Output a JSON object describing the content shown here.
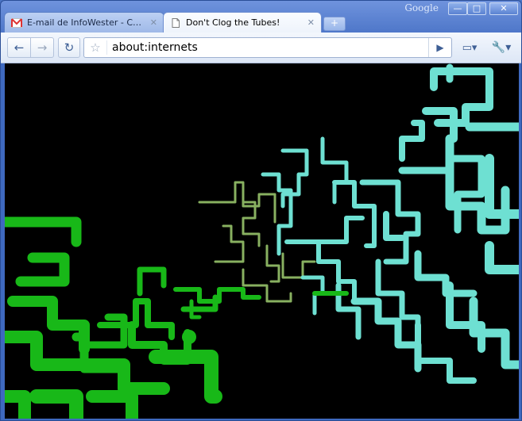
{
  "titlebar": {
    "brand": "Google",
    "minimize_glyph": "—",
    "maximize_glyph": "□",
    "close_glyph": "✕"
  },
  "tabs": [
    {
      "title": "E-mail de InfoWester - Cai...",
      "icon": "gmail-icon",
      "active": false
    },
    {
      "title": "Don't Clog the Tubes!",
      "icon": "page-icon",
      "active": true
    }
  ],
  "tab_close_glyph": "✕",
  "new_tab_glyph": "+",
  "toolbar": {
    "back_glyph": "←",
    "forward_glyph": "→",
    "reload_glyph": "↻",
    "star_glyph": "☆",
    "go_glyph": "▶",
    "page_menu_glyph": "▭▾",
    "tools_menu_glyph": "🔧▾"
  },
  "omnibox": {
    "url": "about:internets"
  },
  "content": {
    "description": "3D pipes screensaver",
    "colors": {
      "background": "#000000",
      "cyan_pipes": "#6ee0d2",
      "green_pipes": "#18b818",
      "olive_pipes": "#88b060"
    }
  }
}
